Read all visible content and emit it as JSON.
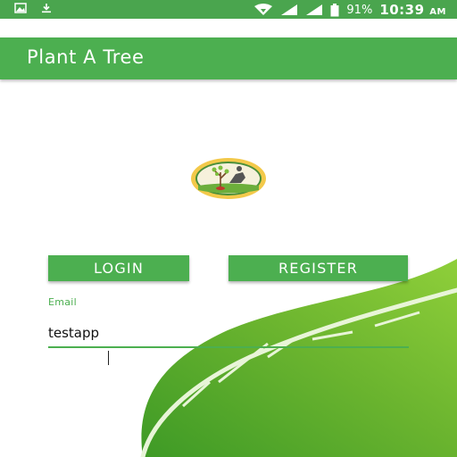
{
  "status_bar": {
    "battery_percent": "91%",
    "time": "10:39",
    "ampm": "AM",
    "icons": [
      "image-icon",
      "download-icon",
      "wifi-icon",
      "signal-icon",
      "signal-icon",
      "battery-icon"
    ]
  },
  "app_bar": {
    "title": "Plant A Tree"
  },
  "form": {
    "email_label": "Email",
    "email_value": "testapp"
  },
  "buttons": {
    "login": "LOGIN",
    "register": "REGISTER"
  },
  "colors": {
    "primary": "#4caf50",
    "status_bar": "#4aa54e",
    "leaf": "#6ab530"
  }
}
